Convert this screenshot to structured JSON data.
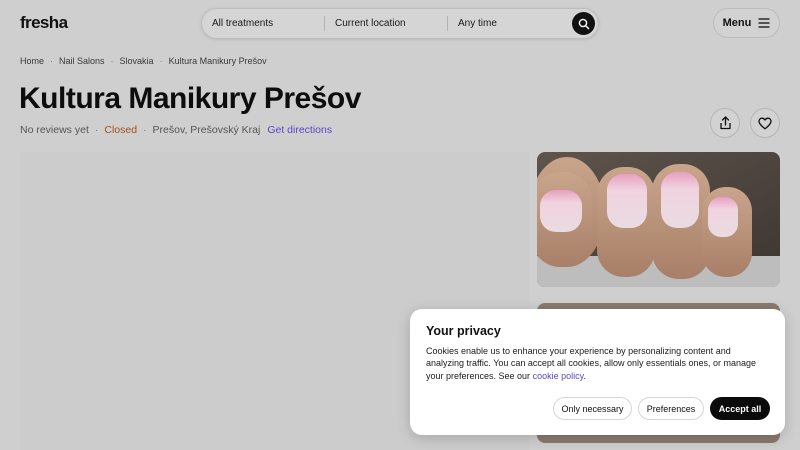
{
  "header": {
    "logo": "fresha",
    "search": {
      "treatments": "All treatments",
      "location": "Current location",
      "time": "Any time"
    },
    "menu_label": "Menu"
  },
  "breadcrumb": [
    "Home",
    "Nail Salons",
    "Slovakia",
    "Kultura Manikury Prešov"
  ],
  "venue": {
    "title": "Kultura Manikury Prešov",
    "reviews": "No reviews yet",
    "status": "Closed",
    "location": "Prešov, Prešovský Kraj",
    "directions": "Get directions"
  },
  "cookie": {
    "title": "Your privacy",
    "text": "Cookies enable us to enhance your experience by personalizing content and analyzing traffic. You can accept all cookies, allow only essentials ones, or manage your preferences. See our",
    "link": "cookie policy",
    "link_suffix": ".",
    "buttons": {
      "only_necessary": "Only necessary",
      "preferences": "Preferences",
      "accept_all": "Accept all"
    }
  },
  "colors": {
    "status_closed": "#a0521b",
    "link": "#5b47c7",
    "primary": "#0b0b0b"
  },
  "icons": [
    "search-icon",
    "menu-icon",
    "share-icon",
    "heart-icon"
  ]
}
